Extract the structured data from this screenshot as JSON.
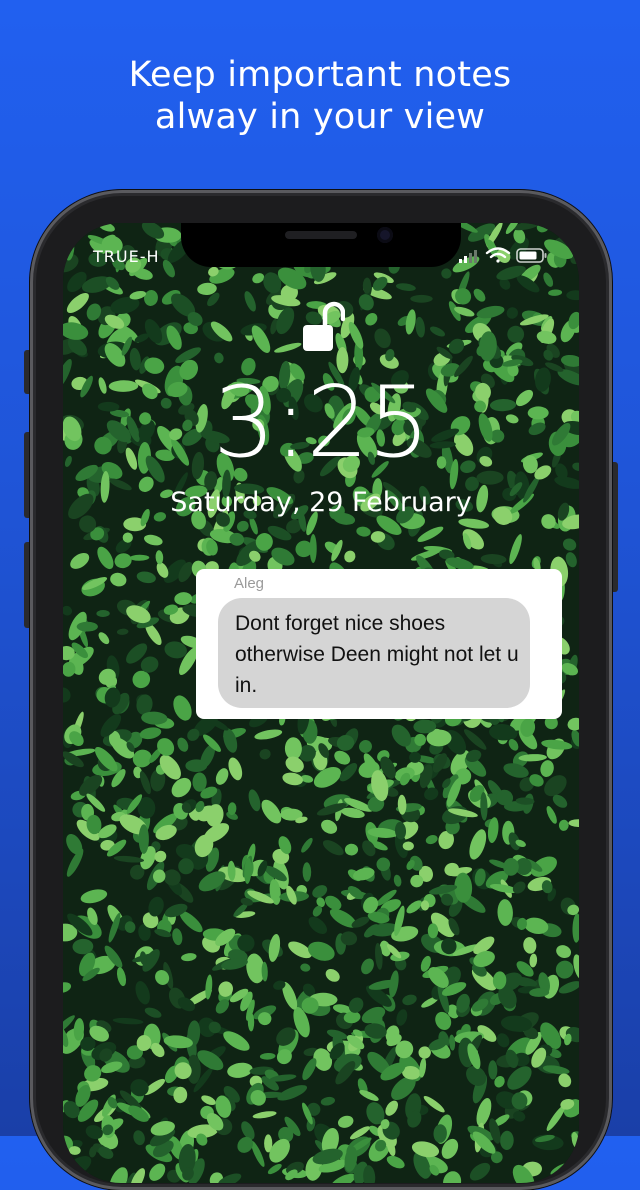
{
  "headline": {
    "line1": "Keep important notes",
    "line2": "alway in your view"
  },
  "status_bar": {
    "carrier": "TRUE-H",
    "icons": [
      "signal-icon",
      "wifi-icon",
      "battery-icon"
    ]
  },
  "lock_screen": {
    "lock_icon": "unlocked-padlock-icon",
    "time": "3:25",
    "date": "Saturday, 29 February"
  },
  "note": {
    "sender": "Aleg",
    "message": "Dont forget nice shoes otherwise Deen might not let u in."
  },
  "colors": {
    "background_top": "#2160f0",
    "background_bottom": "#1a3fa8",
    "bubble": "#d5d5d5",
    "card": "#ffffff"
  }
}
